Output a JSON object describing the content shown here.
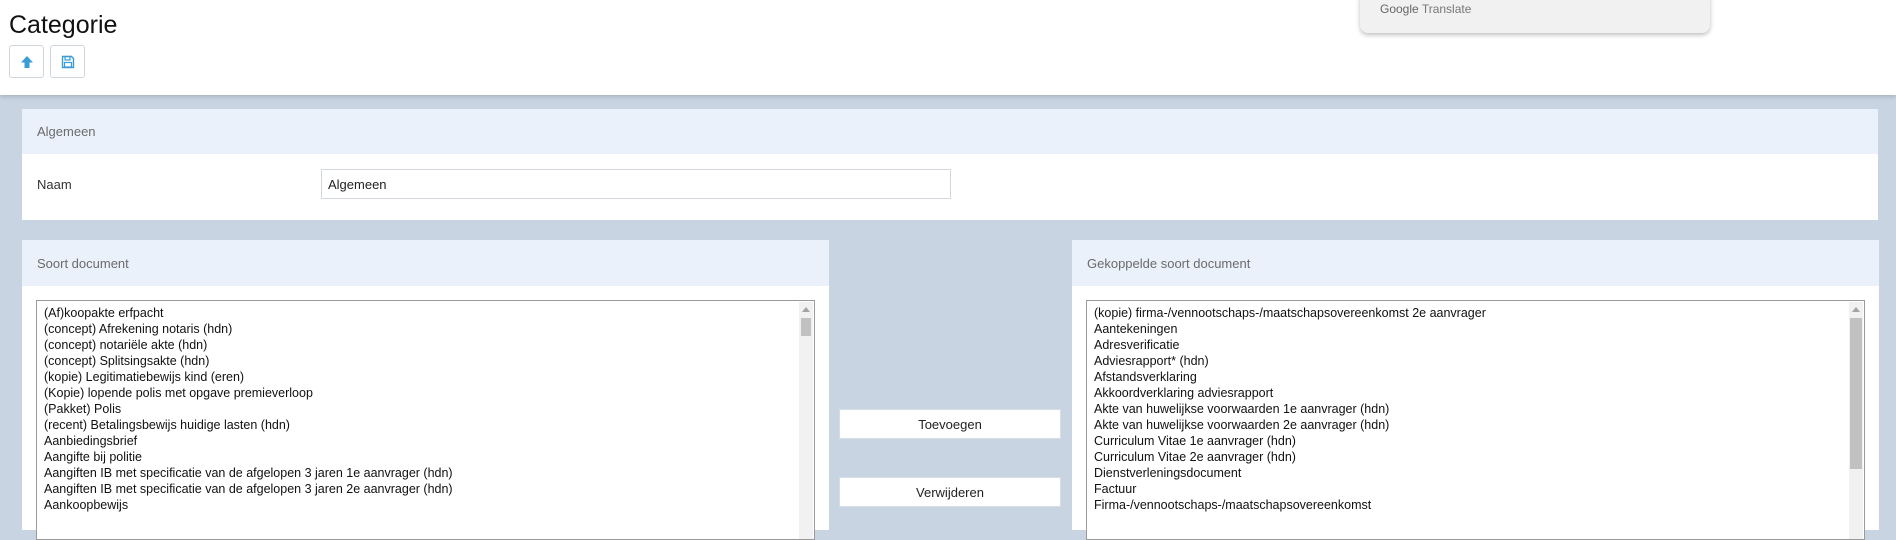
{
  "page": {
    "title": "Categorie"
  },
  "toolbar": {
    "up_icon": "arrow-up-icon",
    "save_icon": "floppy-disk-icon"
  },
  "google_translate": {
    "brand": "Google",
    "product": "Translate"
  },
  "general_panel": {
    "header": "Algemeen",
    "name_label": "Naam",
    "name_value": "Algemeen"
  },
  "available_panel": {
    "header": "Soort document",
    "items": [
      "(Af)koopakte erfpacht",
      "(concept) Afrekening notaris (hdn)",
      "(concept) notariële akte (hdn)",
      "(concept) Splitsingsakte (hdn)",
      "(kopie) Legitimatiebewijs kind (eren)",
      "(Kopie) lopende polis met opgave premieverloop",
      "(Pakket) Polis",
      "(recent) Betalingsbewijs huidige lasten (hdn)",
      "Aanbiedingsbrief",
      "Aangifte bij politie",
      "Aangiften IB met specificatie van de afgelopen 3 jaren 1e aanvrager (hdn)",
      "Aangiften IB met specificatie van de afgelopen 3 jaren 2e aanvrager (hdn)",
      "Aankoopbewijs"
    ]
  },
  "actions": {
    "add_label": "Toevoegen",
    "remove_label": "Verwijderen"
  },
  "linked_panel": {
    "header": "Gekoppelde soort document",
    "items": [
      "(kopie) firma-/vennootschaps-/maatschapsovereenkomst 2e aanvrager",
      "Aantekeningen",
      "Adresverificatie",
      "Adviesrapport* (hdn)",
      "Afstandsverklaring",
      "Akkoordverklaring adviesrapport",
      "Akte van huwelijkse voorwaarden 1e aanvrager (hdn)",
      "Akte van huwelijkse voorwaarden 2e aanvrager (hdn)",
      "Curriculum Vitae 1e aanvrager (hdn)",
      "Curriculum Vitae 2e aanvrager (hdn)",
      "Dienstverleningsdocument",
      "Factuur",
      "Firma-/vennootschaps-/maatschapsovereenkomst"
    ]
  },
  "colors": {
    "background": "#c8d4e2",
    "panel_header": "#eaf1fa",
    "icon_accent": "#3b9bd4"
  }
}
